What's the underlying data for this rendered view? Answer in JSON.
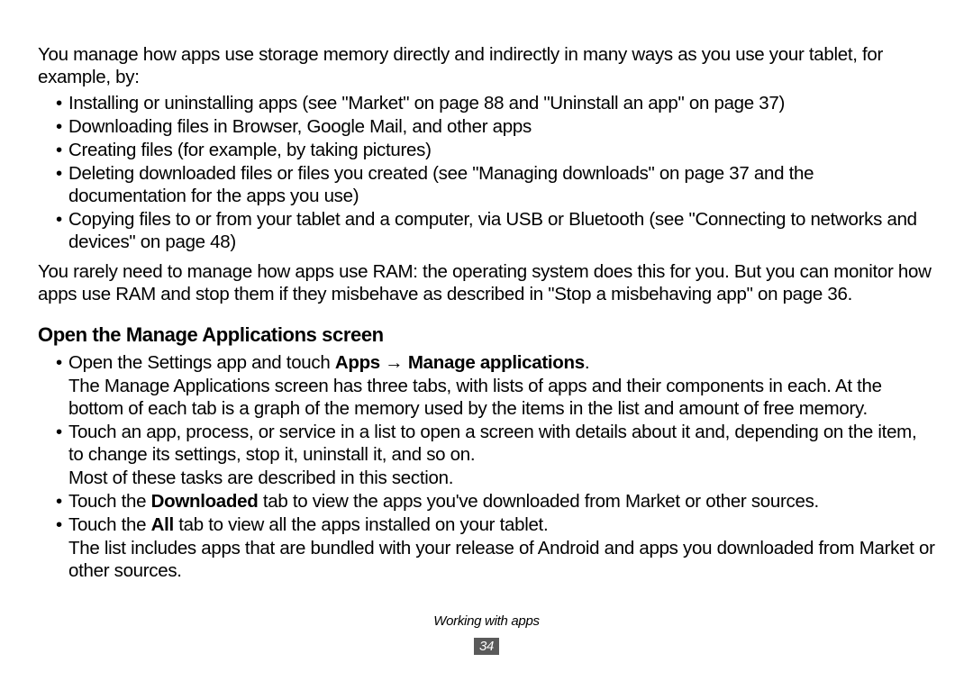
{
  "intro": "You manage how apps use storage memory directly and indirectly in many ways as you use your tablet, for example, by:",
  "storageList": [
    "Installing or uninstalling apps (see \"Market\" on page 88 and \"Uninstall an app\" on page 37)",
    "Downloading files in Browser, Google Mail, and other apps",
    "Creating files (for example, by taking pictures)",
    "Deleting downloaded files or files you created (see \"Managing downloads\" on page 37 and the documentation for the apps you use)",
    "Copying files to or from your tablet and a computer, via USB or Bluetooth (see \"Connecting to networks and devices\" on page 48)"
  ],
  "afterList": "You rarely need to manage how apps use RAM: the operating system does this for you. But you can monitor how apps use RAM and stop them if they misbehave as described in \"Stop a misbehaving app\" on page 36.",
  "sectionHeading": "Open the Manage Applications screen",
  "openItem": {
    "prefix": "Open the Settings app and touch ",
    "bold": "Apps → Manage applications",
    "suffix": ".",
    "continue": "The Manage Applications screen has three tabs, with lists of apps and their components in each. At the bottom of each tab is a graph of the memory used by the items in the list and amount of free memory."
  },
  "touchItem": {
    "text": "Touch an app, process, or service in a list to open a screen with details about it and, depending on the item, to change its settings, stop it, uninstall it, and so on.",
    "continue": "Most of these tasks are described in this section."
  },
  "downloadedItem": {
    "prefix": "Touch the ",
    "bold": "Downloaded",
    "suffix": " tab to view the apps you've downloaded from Market or other sources."
  },
  "allItem": {
    "prefix": "Touch the ",
    "bold": "All",
    "suffix": " tab to view all the apps installed on your tablet.",
    "continue": "The list includes apps that are bundled with your release of Android and apps you downloaded from Market or other sources."
  },
  "footer": {
    "title": "Working with apps",
    "page": "34"
  }
}
